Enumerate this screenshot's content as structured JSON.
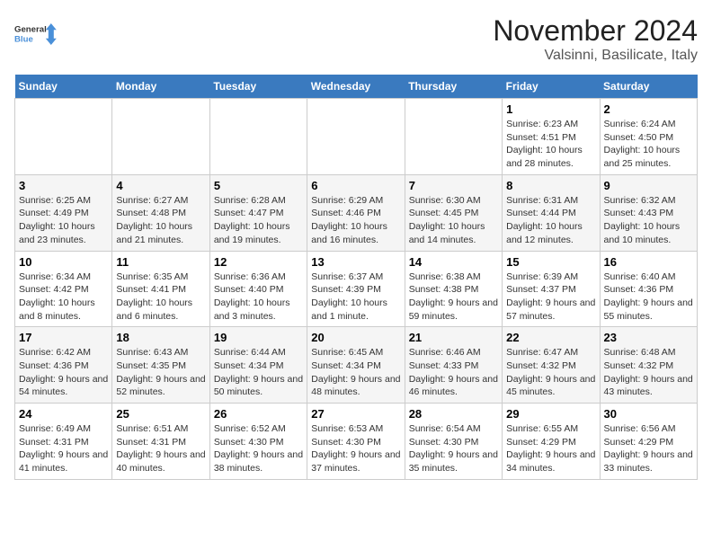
{
  "logo": {
    "line1": "General",
    "line2": "Blue"
  },
  "title": "November 2024",
  "location": "Valsinni, Basilicate, Italy",
  "days_of_week": [
    "Sunday",
    "Monday",
    "Tuesday",
    "Wednesday",
    "Thursday",
    "Friday",
    "Saturday"
  ],
  "weeks": [
    [
      {
        "day": "",
        "info": ""
      },
      {
        "day": "",
        "info": ""
      },
      {
        "day": "",
        "info": ""
      },
      {
        "day": "",
        "info": ""
      },
      {
        "day": "",
        "info": ""
      },
      {
        "day": "1",
        "info": "Sunrise: 6:23 AM\nSunset: 4:51 PM\nDaylight: 10 hours and 28 minutes."
      },
      {
        "day": "2",
        "info": "Sunrise: 6:24 AM\nSunset: 4:50 PM\nDaylight: 10 hours and 25 minutes."
      }
    ],
    [
      {
        "day": "3",
        "info": "Sunrise: 6:25 AM\nSunset: 4:49 PM\nDaylight: 10 hours and 23 minutes."
      },
      {
        "day": "4",
        "info": "Sunrise: 6:27 AM\nSunset: 4:48 PM\nDaylight: 10 hours and 21 minutes."
      },
      {
        "day": "5",
        "info": "Sunrise: 6:28 AM\nSunset: 4:47 PM\nDaylight: 10 hours and 19 minutes."
      },
      {
        "day": "6",
        "info": "Sunrise: 6:29 AM\nSunset: 4:46 PM\nDaylight: 10 hours and 16 minutes."
      },
      {
        "day": "7",
        "info": "Sunrise: 6:30 AM\nSunset: 4:45 PM\nDaylight: 10 hours and 14 minutes."
      },
      {
        "day": "8",
        "info": "Sunrise: 6:31 AM\nSunset: 4:44 PM\nDaylight: 10 hours and 12 minutes."
      },
      {
        "day": "9",
        "info": "Sunrise: 6:32 AM\nSunset: 4:43 PM\nDaylight: 10 hours and 10 minutes."
      }
    ],
    [
      {
        "day": "10",
        "info": "Sunrise: 6:34 AM\nSunset: 4:42 PM\nDaylight: 10 hours and 8 minutes."
      },
      {
        "day": "11",
        "info": "Sunrise: 6:35 AM\nSunset: 4:41 PM\nDaylight: 10 hours and 6 minutes."
      },
      {
        "day": "12",
        "info": "Sunrise: 6:36 AM\nSunset: 4:40 PM\nDaylight: 10 hours and 3 minutes."
      },
      {
        "day": "13",
        "info": "Sunrise: 6:37 AM\nSunset: 4:39 PM\nDaylight: 10 hours and 1 minute."
      },
      {
        "day": "14",
        "info": "Sunrise: 6:38 AM\nSunset: 4:38 PM\nDaylight: 9 hours and 59 minutes."
      },
      {
        "day": "15",
        "info": "Sunrise: 6:39 AM\nSunset: 4:37 PM\nDaylight: 9 hours and 57 minutes."
      },
      {
        "day": "16",
        "info": "Sunrise: 6:40 AM\nSunset: 4:36 PM\nDaylight: 9 hours and 55 minutes."
      }
    ],
    [
      {
        "day": "17",
        "info": "Sunrise: 6:42 AM\nSunset: 4:36 PM\nDaylight: 9 hours and 54 minutes."
      },
      {
        "day": "18",
        "info": "Sunrise: 6:43 AM\nSunset: 4:35 PM\nDaylight: 9 hours and 52 minutes."
      },
      {
        "day": "19",
        "info": "Sunrise: 6:44 AM\nSunset: 4:34 PM\nDaylight: 9 hours and 50 minutes."
      },
      {
        "day": "20",
        "info": "Sunrise: 6:45 AM\nSunset: 4:34 PM\nDaylight: 9 hours and 48 minutes."
      },
      {
        "day": "21",
        "info": "Sunrise: 6:46 AM\nSunset: 4:33 PM\nDaylight: 9 hours and 46 minutes."
      },
      {
        "day": "22",
        "info": "Sunrise: 6:47 AM\nSunset: 4:32 PM\nDaylight: 9 hours and 45 minutes."
      },
      {
        "day": "23",
        "info": "Sunrise: 6:48 AM\nSunset: 4:32 PM\nDaylight: 9 hours and 43 minutes."
      }
    ],
    [
      {
        "day": "24",
        "info": "Sunrise: 6:49 AM\nSunset: 4:31 PM\nDaylight: 9 hours and 41 minutes."
      },
      {
        "day": "25",
        "info": "Sunrise: 6:51 AM\nSunset: 4:31 PM\nDaylight: 9 hours and 40 minutes."
      },
      {
        "day": "26",
        "info": "Sunrise: 6:52 AM\nSunset: 4:30 PM\nDaylight: 9 hours and 38 minutes."
      },
      {
        "day": "27",
        "info": "Sunrise: 6:53 AM\nSunset: 4:30 PM\nDaylight: 9 hours and 37 minutes."
      },
      {
        "day": "28",
        "info": "Sunrise: 6:54 AM\nSunset: 4:30 PM\nDaylight: 9 hours and 35 minutes."
      },
      {
        "day": "29",
        "info": "Sunrise: 6:55 AM\nSunset: 4:29 PM\nDaylight: 9 hours and 34 minutes."
      },
      {
        "day": "30",
        "info": "Sunrise: 6:56 AM\nSunset: 4:29 PM\nDaylight: 9 hours and 33 minutes."
      }
    ]
  ]
}
